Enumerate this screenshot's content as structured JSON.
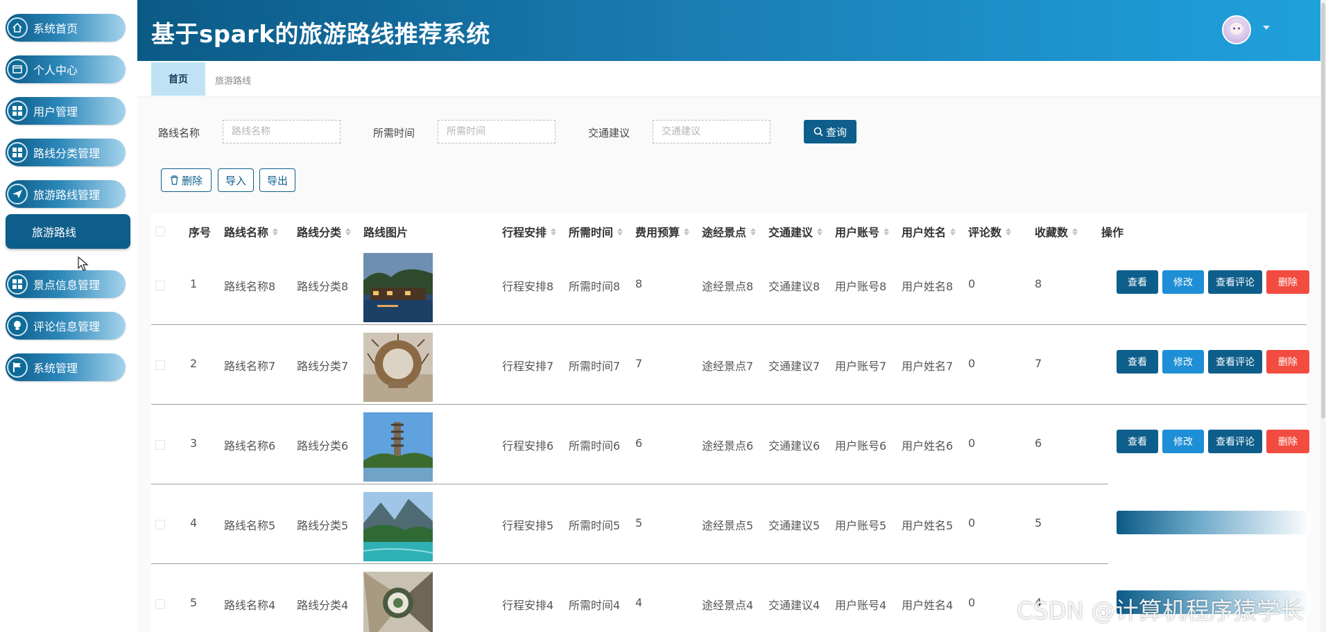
{
  "app": {
    "title": "基于spark的旅游路线推荐系统"
  },
  "sidebar": {
    "items": [
      {
        "label": "系统首页",
        "icon": "home-icon"
      },
      {
        "label": "个人中心",
        "icon": "id-card-icon"
      },
      {
        "label": "用户管理",
        "icon": "grid-icon"
      },
      {
        "label": "路线分类管理",
        "icon": "grid-icon"
      },
      {
        "label": "旅游路线管理",
        "icon": "paper-plane-icon"
      },
      {
        "label": "景点信息管理",
        "icon": "grid-icon"
      },
      {
        "label": "评论信息管理",
        "icon": "lightbulb-icon"
      },
      {
        "label": "系统管理",
        "icon": "flag-icon"
      }
    ],
    "active_sub": "旅游路线"
  },
  "breadcrumb": {
    "home": "首页",
    "current": "旅游路线"
  },
  "filters": {
    "name_label": "路线名称",
    "name_placeholder": "路线名称",
    "time_label": "所需时间",
    "time_placeholder": "所需时间",
    "traffic_label": "交通建议",
    "traffic_placeholder": "交通建议",
    "query_label": "查询"
  },
  "toolbar": {
    "delete_label": "删除",
    "import_label": "导入",
    "export_label": "导出"
  },
  "table": {
    "headers": {
      "index": "序号",
      "name": "路线名称",
      "category": "路线分类",
      "image": "路线图片",
      "schedule": "行程安排",
      "time": "所需时间",
      "budget": "费用预算",
      "spots": "途经景点",
      "traffic": "交通建议",
      "account": "用户账号",
      "username": "用户姓名",
      "comments": "评论数",
      "favorites": "收藏数",
      "ops": "操作"
    },
    "actions": {
      "view": "查看",
      "edit": "修改",
      "view_comments": "查看评论",
      "delete": "删除"
    },
    "rows": [
      {
        "index": "1",
        "name": "路线名称8",
        "category": "路线分类8",
        "schedule": "行程安排8",
        "time": "所需时间8",
        "budget": "8",
        "spots": "途经景点8",
        "traffic": "交通建议8",
        "account": "用户账号8",
        "username": "用户姓名8",
        "comments": "0",
        "favorites": "8"
      },
      {
        "index": "2",
        "name": "路线名称7",
        "category": "路线分类7",
        "schedule": "行程安排7",
        "time": "所需时间7",
        "budget": "7",
        "spots": "途经景点7",
        "traffic": "交通建议7",
        "account": "用户账号7",
        "username": "用户姓名7",
        "comments": "0",
        "favorites": "7"
      },
      {
        "index": "3",
        "name": "路线名称6",
        "category": "路线分类6",
        "schedule": "行程安排6",
        "time": "所需时间6",
        "budget": "6",
        "spots": "途经景点6",
        "traffic": "交通建议6",
        "account": "用户账号6",
        "username": "用户姓名6",
        "comments": "0",
        "favorites": "6"
      },
      {
        "index": "4",
        "name": "路线名称5",
        "category": "路线分类5",
        "schedule": "行程安排5",
        "time": "所需时间5",
        "budget": "5",
        "spots": "途经景点5",
        "traffic": "交通建议5",
        "account": "用户账号5",
        "username": "用户姓名5",
        "comments": "0",
        "favorites": "5"
      },
      {
        "index": "5",
        "name": "路线名称4",
        "category": "路线分类4",
        "schedule": "行程安排4",
        "time": "所需时间4",
        "budget": "4",
        "spots": "途经景点4",
        "traffic": "交通建议4",
        "account": "用户账号4",
        "username": "用户姓名4",
        "comments": "0",
        "favorites": "4"
      }
    ]
  },
  "watermark": "CSDN @计算机程序猿学长",
  "colors": {
    "primary": "#0e5e8b",
    "edit": "#1e8fd6",
    "danger": "#f24c40",
    "header_end": "#1fa1dc"
  }
}
